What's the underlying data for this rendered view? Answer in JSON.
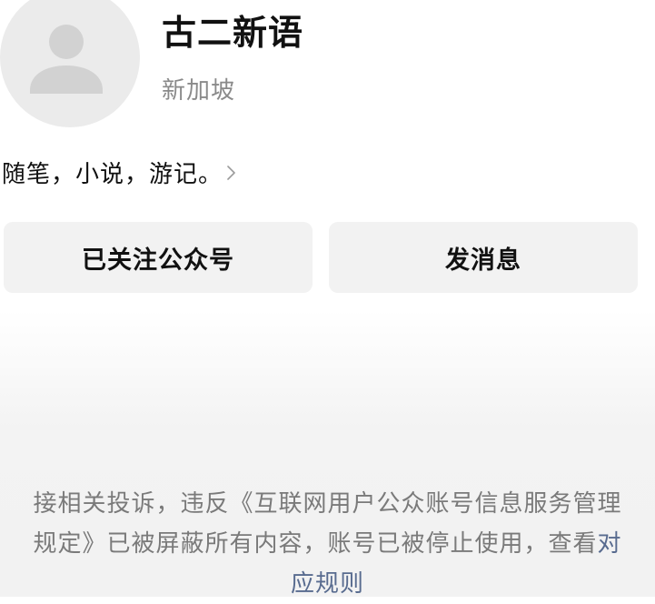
{
  "profile": {
    "name": "古二新语",
    "location": "新加坡",
    "bio": "随笔，小说，游记。"
  },
  "actions": {
    "follow_label": "已关注公众号",
    "message_label": "发消息"
  },
  "notice": {
    "text_before_link": "接相关投诉，违反《互联网用户公众账号信息服务管理规定》已被屏蔽所有内容，账号已被停止使用，查看",
    "link_text": "对应规则"
  },
  "colors": {
    "link": "#586b8f",
    "muted_text": "#7a7a7a",
    "button_bg": "#f2f2f2"
  },
  "icons": {
    "avatar": "default-user-silhouette-icon",
    "bio_chevron": "chevron-right-icon"
  }
}
